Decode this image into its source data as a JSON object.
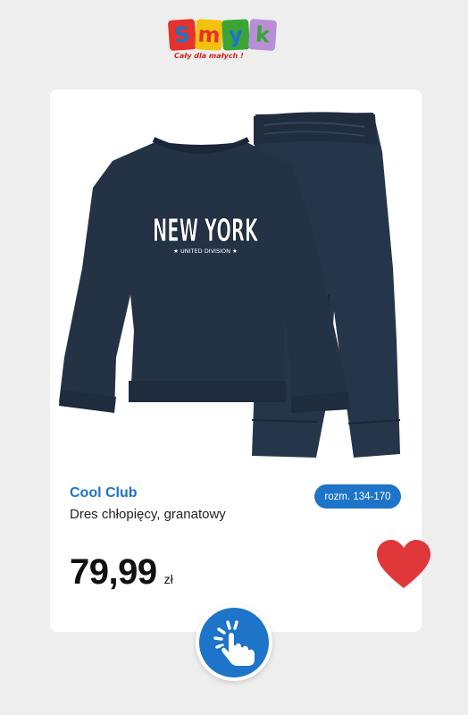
{
  "logo": {
    "letters": [
      "S",
      "m",
      "y",
      "k"
    ],
    "tagline": "Cały dla małych !",
    "colors": [
      "#e5322d",
      "#1d74c8",
      "#f4c20d",
      "#3aa535",
      "#b88fd6"
    ]
  },
  "product": {
    "print_title": "NEW YORK",
    "print_subtitle": "★ UNITED DIVISION ★",
    "brand": "Cool Club",
    "description": "Dres chłopięcy, granatowy",
    "size": "rozm. 134-170",
    "price": "79,99",
    "currency": "zł"
  },
  "colors": {
    "accent": "#1d74c8",
    "heart": "#e0373a",
    "garment": "#233245"
  },
  "icons": [
    "heart-icon",
    "tap-hand-icon"
  ]
}
